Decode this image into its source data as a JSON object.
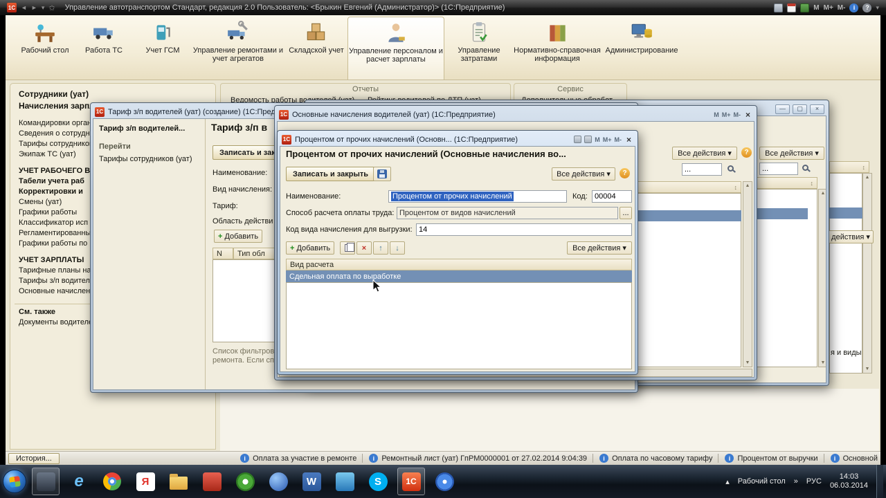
{
  "glyphs": {
    "back": "◄",
    "forward": "►",
    "dropdown": "▾",
    "star": "✩",
    "m": "M",
    "m_plus": "M+",
    "m_minus": "M-",
    "info": "i",
    "help": "?",
    "cross": "×",
    "minimize": "—",
    "maximize": "▢",
    "plus": "+",
    "up": "↑",
    "down": "↓",
    "sort": "↕",
    "scroll_up": "▲",
    "scroll_down": "▼",
    "chevrons": "»",
    "tray_up": "▴"
  },
  "app": {
    "logo": "1С",
    "title": "Управление автотранспортом Стандарт, редакция 2.0   Пользователь: <Брыкин Евгений (Администратор)>  (1С:Предприятие)"
  },
  "ribbon": {
    "sections": [
      {
        "label": "Рабочий стол"
      },
      {
        "label": "Работа ТС"
      },
      {
        "label": "Учет ГСМ"
      },
      {
        "label": "Управление ремонтами и учет агрегатов"
      },
      {
        "label": "Складской учет"
      },
      {
        "label": "Управление персоналом и расчет зарплаты"
      },
      {
        "label": "Управление затратами"
      },
      {
        "label": "Нормативно-справочная информация"
      },
      {
        "label": "Администрирование"
      }
    ]
  },
  "sidebar": {
    "items": [
      {
        "label": "Сотрудники (уат)"
      },
      {
        "label": "Начисления зарплат"
      },
      {
        "label": "Командировки орган"
      },
      {
        "label": "Сведения о сотрудник"
      },
      {
        "label": "Тарифы сотрудников (уат)"
      },
      {
        "label": "Экипаж ТС (уат)"
      },
      {
        "label": "УЧЕТ РАБОЧЕГО В"
      },
      {
        "label": "Табели учета раб"
      },
      {
        "label": "Корректировки и"
      },
      {
        "label": "Смены (уат)"
      },
      {
        "label": "Графики работы"
      },
      {
        "label": "Классификатор исп"
      },
      {
        "label": "Регламентированны"
      },
      {
        "label": "Графики работы по"
      },
      {
        "label": "УЧЕТ ЗАРПЛАТЫ"
      },
      {
        "label": "Тарифные планы нач"
      },
      {
        "label": "Тарифы з/п водител"
      },
      {
        "label": "Основные начислен"
      },
      {
        "label": "См. также"
      },
      {
        "label": "Документы водителей"
      }
    ]
  },
  "panels": {
    "reports": {
      "title": "Отчеты",
      "items": [
        "Ведомость работы водителей (уат)",
        "Рейтинг водителей по ДТП (уат)"
      ]
    },
    "service": {
      "title": "Сервис",
      "items": [
        "Дополнительные обработ"
      ]
    }
  },
  "background": {
    "all_actions": "Все действия",
    "search": "...",
    "actions_fragment": "действия",
    "text_fragment": "я и виды"
  },
  "window_tarif": {
    "title": "Тариф з/п водителей (уат) (создание) (1С:Предприятие)",
    "nav_header": "Тариф з/п водителей...",
    "nav_section": "Перейти",
    "nav_link": "Тарифы сотрудников (уат)",
    "heading": "Тариф з/п в",
    "save_button": "Записать и закр",
    "field_name": "Наименование:",
    "field_kind": "Вид начисления:",
    "field_tarif": "Тариф:",
    "group_area": "Область действи",
    "add_button": "Добавить",
    "col_n": "N",
    "col_type": "Тип обл",
    "hint_line1": "Список фильтров,",
    "hint_line2": "ремонта. Если сп"
  },
  "window_list": {
    "title": "Основные начисления водителей (уат) (1С:Предприятие)",
    "all_actions": "Все действия",
    "search": "..."
  },
  "window_dialog": {
    "title": "Процентом от прочих начислений (Основн...  (1С:Предприятие)",
    "heading": "Процентом от прочих начислений (Основные начисления во...",
    "save_close": "Записать и закрыть",
    "all_actions": "Все действия",
    "name_label": "Наименование:",
    "name_value": "Процентом от прочих начислений",
    "code_label": "Код:",
    "code_value": "00004",
    "method_label": "Способ расчета оплаты труда:",
    "method_value": "Процентом от видов начислений",
    "ellipsis_button": "...",
    "export_label": "Код вида начисления для выгрузки:",
    "export_value": "14",
    "add_button": "Добавить",
    "table_header": "Вид расчета",
    "row_value": "Сдельная оплата по выработке"
  },
  "statusbar": {
    "history": "История...",
    "messages": [
      "Оплата за участие в ремонте",
      "Ремонтный лист (уат) ГпРМ0000001 от 27.02.2014 9:04:39",
      "Оплата по часовому тарифу",
      "Процентом от выручки",
      "Основной"
    ]
  },
  "taskbar": {
    "desktop_label": "Рабочий стол",
    "lang": "РУС",
    "time": "14:03",
    "date": "06.03.2014",
    "icons": [
      {
        "name": "app-window",
        "letter": ""
      },
      {
        "name": "internet-explorer",
        "letter": "e"
      },
      {
        "name": "chrome",
        "letter": ""
      },
      {
        "name": "yandex",
        "letter": "Я"
      },
      {
        "name": "folder",
        "letter": ""
      },
      {
        "name": "red-app",
        "letter": ""
      },
      {
        "name": "green-flower-app",
        "letter": ""
      },
      {
        "name": "blue-orb-app",
        "letter": ""
      },
      {
        "name": "word",
        "letter": "W"
      },
      {
        "name": "monitor-app",
        "letter": ""
      },
      {
        "name": "skype",
        "letter": "S"
      },
      {
        "name": "one-c",
        "letter": "1С"
      },
      {
        "name": "blue-flower-app",
        "letter": ""
      }
    ]
  }
}
